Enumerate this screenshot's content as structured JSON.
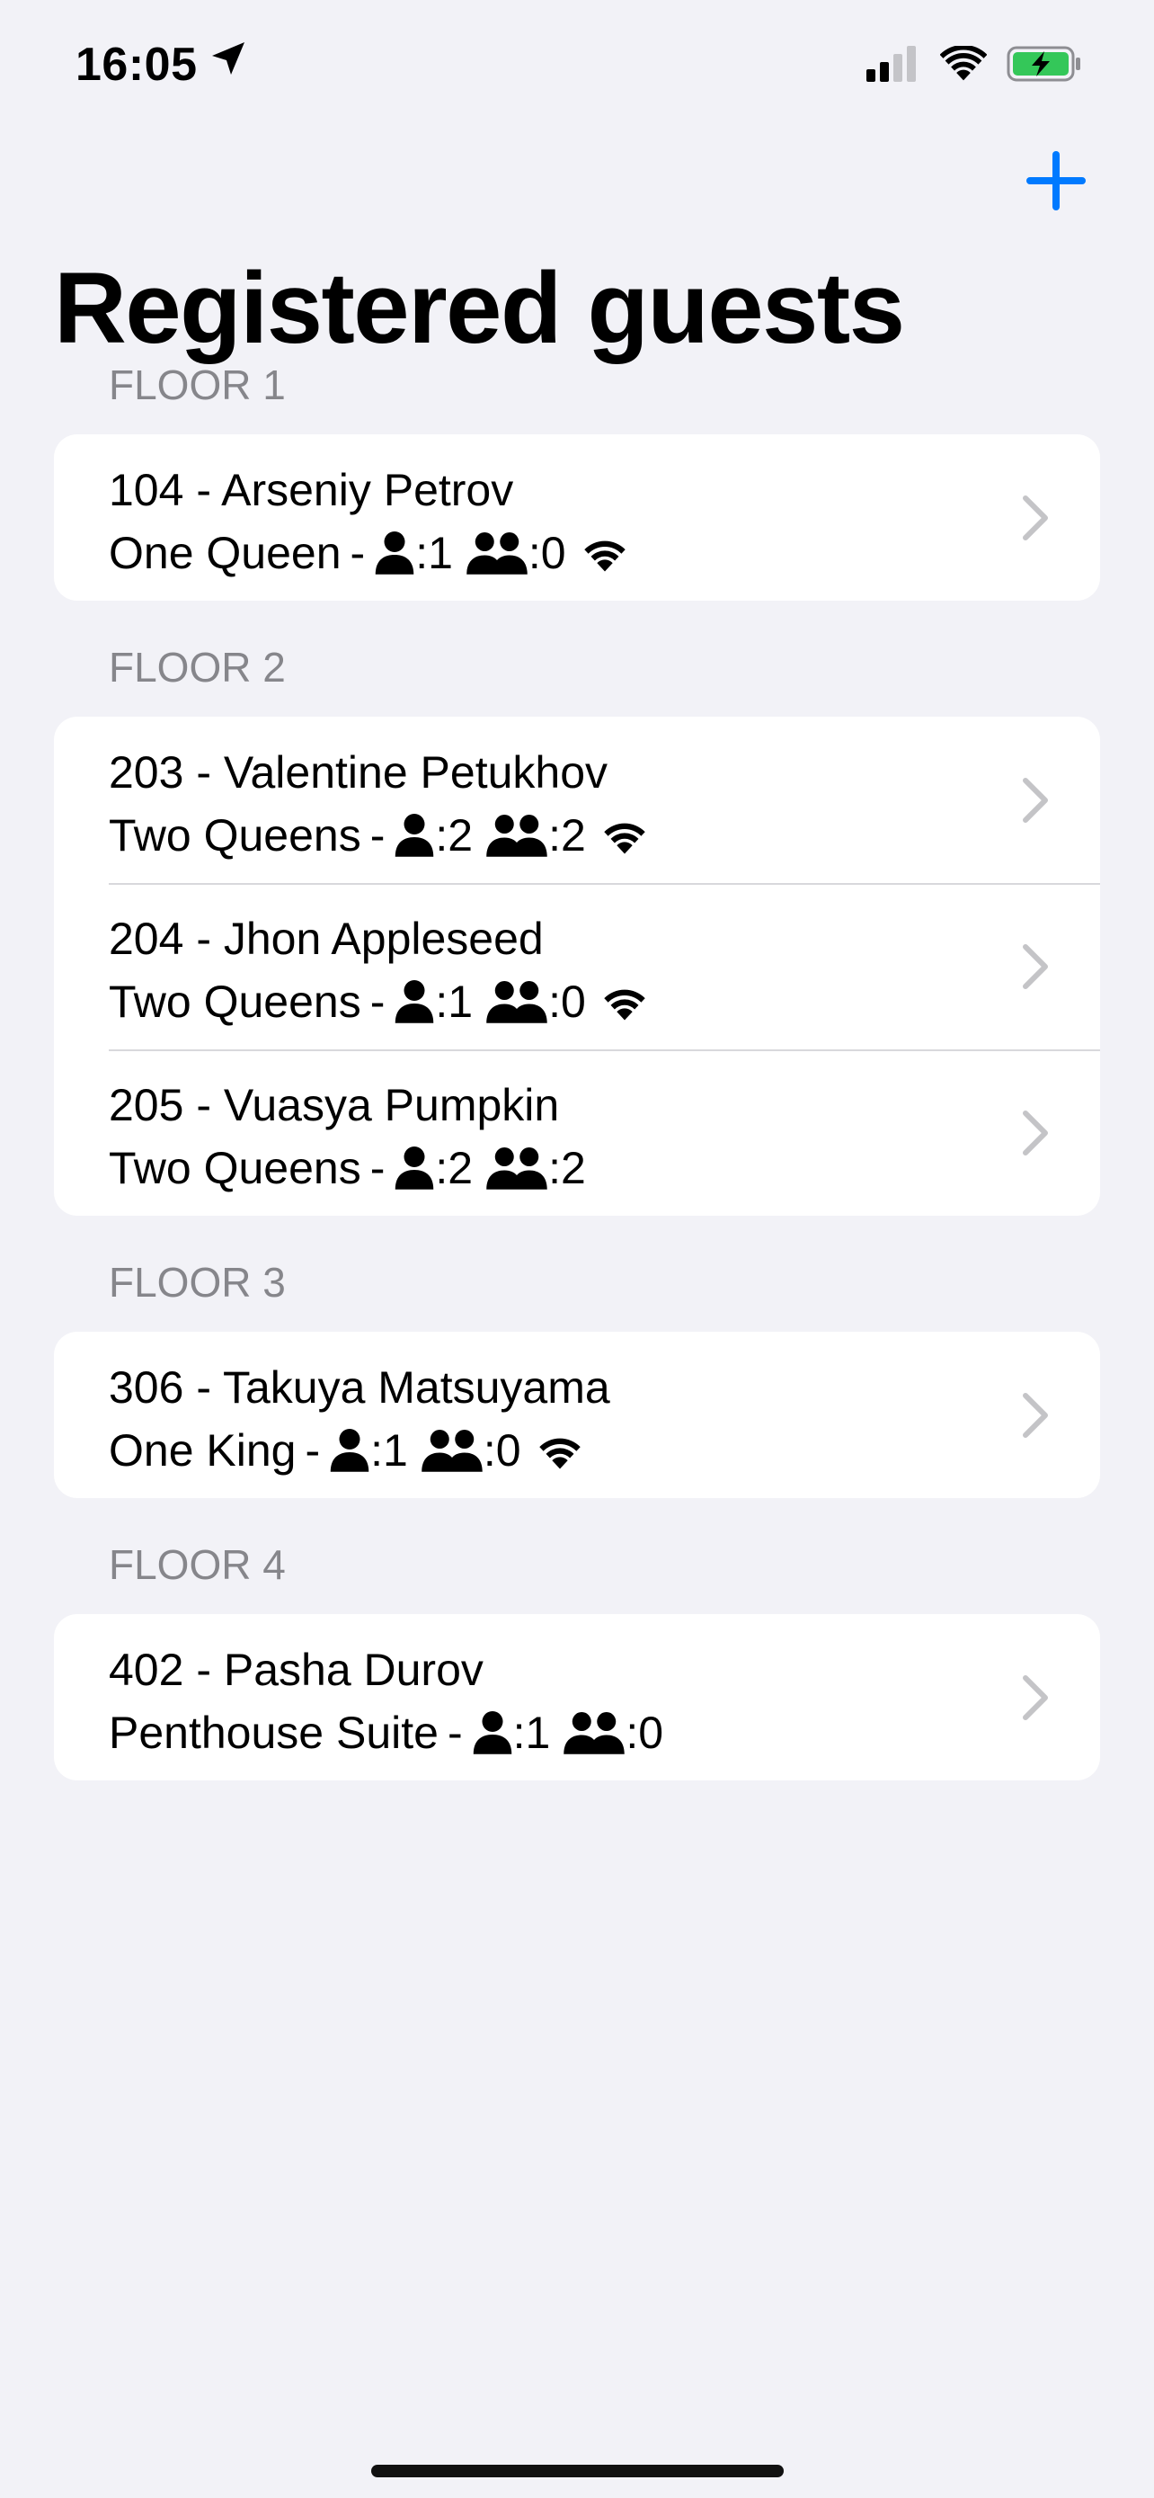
{
  "status_bar": {
    "time": "16:05",
    "icons": [
      "location-arrow-icon",
      "cellular-signal-icon",
      "wifi-icon",
      "battery-charging-icon"
    ],
    "battery_color": "#34c759"
  },
  "nav": {
    "add_icon": "plus-icon",
    "accent_color": "#007aff"
  },
  "title": "Registered guests",
  "sections": [
    {
      "header": "FLOOR 1",
      "rows": [
        {
          "title": "104 - Arseniy Petrov",
          "room_type": "One Queen",
          "adults": ":1",
          "children": ":0",
          "wifi": true
        }
      ]
    },
    {
      "header": "FLOOR 2",
      "rows": [
        {
          "title": "203 - Valentine  Petukhov",
          "room_type": "Two Queens",
          "adults": ":2",
          "children": ":2",
          "wifi": true
        },
        {
          "title": "204 - Jhon Appleseed",
          "room_type": "Two Queens",
          "adults": ":1",
          "children": ":0",
          "wifi": true
        },
        {
          "title": "205 - Vuasya Pumpkin",
          "room_type": "Two Queens",
          "adults": ":2",
          "children": ":2",
          "wifi": false
        }
      ]
    },
    {
      "header": "FLOOR 3",
      "rows": [
        {
          "title": "306 - Takuya Matsuyama",
          "room_type": "One King",
          "adults": ":1",
          "children": ":0",
          "wifi": true
        }
      ]
    },
    {
      "header": "FLOOR 4",
      "rows": [
        {
          "title": "402 - Pasha Durov",
          "room_type": "Penthouse Suite",
          "adults": ":1",
          "children": ":0",
          "wifi": false
        }
      ]
    }
  ],
  "separator": "-"
}
